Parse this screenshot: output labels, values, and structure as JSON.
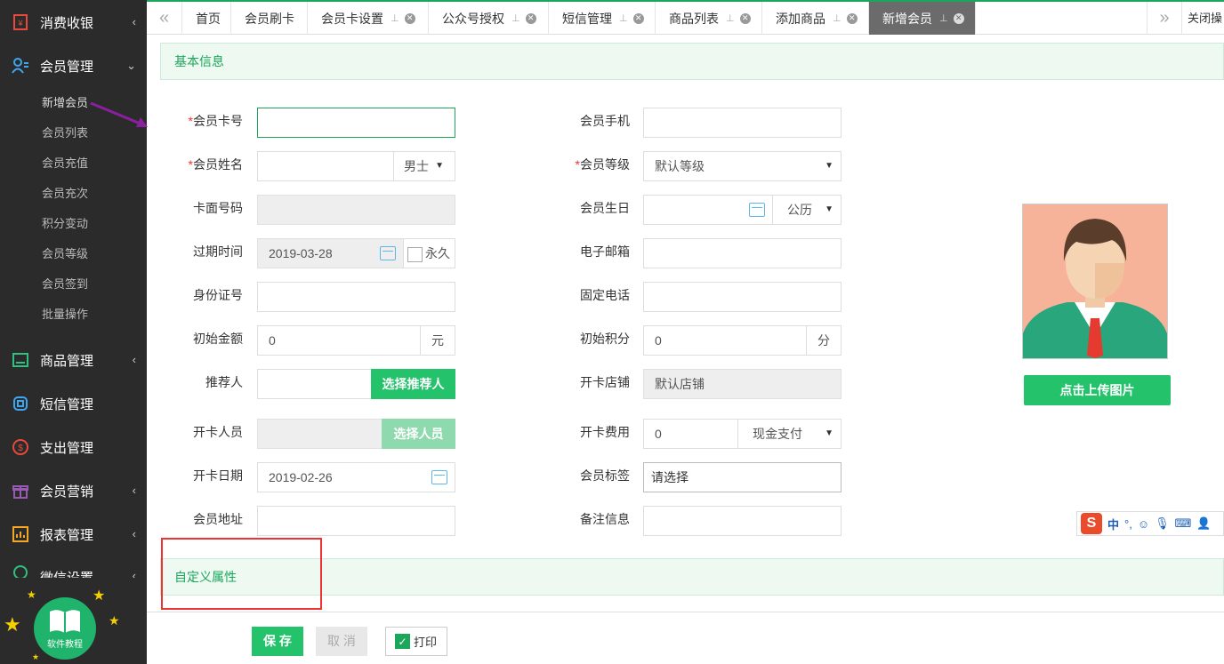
{
  "sidebar": {
    "menus": [
      {
        "label": "消费收银",
        "icon": "cash-register-icon",
        "expanded": false
      },
      {
        "label": "会员管理",
        "icon": "members-icon",
        "expanded": true
      },
      {
        "label": "商品管理",
        "icon": "goods-icon",
        "expanded": false
      },
      {
        "label": "短信管理",
        "icon": "sms-icon",
        "expanded": false
      },
      {
        "label": "支出管理",
        "icon": "expense-icon",
        "expanded": false
      },
      {
        "label": "会员营销",
        "icon": "gift-icon",
        "expanded": false
      },
      {
        "label": "报表管理",
        "icon": "report-icon",
        "expanded": false
      },
      {
        "label": "微信设置",
        "icon": "wechat-icon",
        "expanded": false
      }
    ],
    "submenu": [
      "新增会员",
      "会员列表",
      "会员充值",
      "会员充次",
      "积分变动",
      "会员等级",
      "会员签到",
      "批量操作"
    ],
    "tutorial_label": "软件教程"
  },
  "tabs": [
    {
      "label": "首页"
    },
    {
      "label": "会员刷卡"
    },
    {
      "label": "会员卡设置"
    },
    {
      "label": "公众号授权"
    },
    {
      "label": "短信管理"
    },
    {
      "label": "商品列表"
    },
    {
      "label": "添加商品"
    },
    {
      "label": "新增会员",
      "active": true
    }
  ],
  "tab_close_all": "关闭操",
  "sections": {
    "basic": "基本信息",
    "custom": "自定义属性"
  },
  "form": {
    "card_no": {
      "label": "会员卡号",
      "required": true,
      "value": ""
    },
    "phone": {
      "label": "会员手机",
      "value": ""
    },
    "name": {
      "label": "会员姓名",
      "required": true,
      "value": "",
      "gender": "男士"
    },
    "level": {
      "label": "会员等级",
      "required": true,
      "value": "默认等级"
    },
    "card_face": {
      "label": "卡面号码",
      "value": ""
    },
    "birthday": {
      "label": "会员生日",
      "value": "",
      "calendar": "公历"
    },
    "expire": {
      "label": "过期时间",
      "value": "2019-03-28",
      "forever": "永久"
    },
    "email": {
      "label": "电子邮箱",
      "value": ""
    },
    "id_no": {
      "label": "身份证号",
      "value": ""
    },
    "tel": {
      "label": "固定电话",
      "value": ""
    },
    "init_amount": {
      "label": "初始金额",
      "value": "0",
      "unit": "元"
    },
    "init_points": {
      "label": "初始积分",
      "value": "0",
      "unit": "分"
    },
    "referrer": {
      "label": "推荐人",
      "value": "",
      "button": "选择推荐人"
    },
    "store": {
      "label": "开卡店铺",
      "value": "默认店铺"
    },
    "staff": {
      "label": "开卡人员",
      "value": "",
      "button": "选择人员"
    },
    "fee": {
      "label": "开卡费用",
      "value": "0",
      "pay": "现金支付"
    },
    "open_date": {
      "label": "开卡日期",
      "value": "2019-02-26"
    },
    "tags": {
      "label": "会员标签",
      "value": "请选择"
    },
    "address": {
      "label": "会员地址",
      "value": ""
    },
    "remark": {
      "label": "备注信息",
      "value": ""
    }
  },
  "upload_button": "点击上传图片",
  "footer": {
    "save": "保 存",
    "cancel": "取 消",
    "print": "打印",
    "print_checked": true
  },
  "ime": {
    "lang": "中"
  },
  "colors": {
    "accent": "#23c26b",
    "sidebar": "#2b2b2b",
    "highlight": "#e33"
  }
}
